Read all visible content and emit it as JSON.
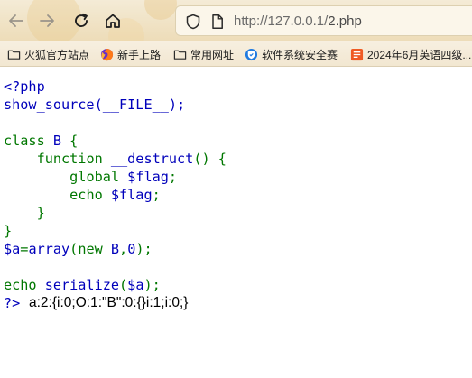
{
  "browser": {
    "url_host": "http://127.0.0.1/",
    "url_path": "2.php"
  },
  "bookmarks": [
    {
      "label": "火狐官方站点",
      "icon": "folder-icon"
    },
    {
      "label": "新手上路",
      "icon": "firefox-icon"
    },
    {
      "label": "常用网址",
      "icon": "folder-icon"
    },
    {
      "label": "软件系统安全赛",
      "icon": "site-shield-icon"
    },
    {
      "label": "2024年6月英语四级...",
      "icon": "site-orange-icon"
    }
  ],
  "code": {
    "line1": "<?php",
    "line2": "show_source(__FILE__);",
    "line4a": "class ",
    "line4b": "B ",
    "line4c": "{",
    "line5": "function ",
    "line5b": "__destruct",
    "line5c": "() ",
    "line5d": "{",
    "line6a": "global ",
    "line6b": "$flag",
    "line6c": ";",
    "line7a": "echo ",
    "line7b": "$flag",
    "line7c": ";",
    "line8": "}",
    "line9": "}",
    "line10a": "$a",
    "line10b": "=",
    "line10c": "array",
    "line10d": "(new ",
    "line10e": "B",
    "line10f": ",",
    "line10g": "0",
    "line10h": ");",
    "line12a": "echo ",
    "line12b": "serialize",
    "line12c": "(",
    "line12d": "$a",
    "line12e": ");",
    "line13": "?>"
  },
  "output": "a:2:{i:0;O:1:\"B\":0:{}i:1;i:0;}"
}
